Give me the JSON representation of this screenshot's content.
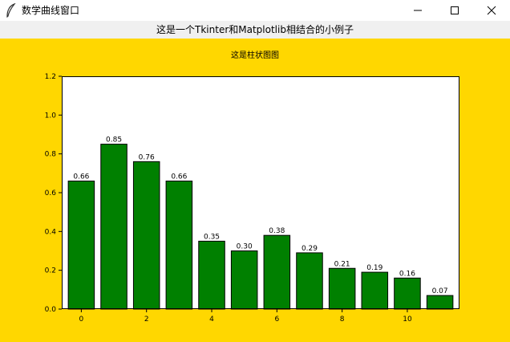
{
  "window": {
    "title": "数学曲线窗口",
    "controls": {
      "minimize": "minimize-icon",
      "maximize": "maximize-icon",
      "close": "close-icon"
    }
  },
  "header_label": "这是一个Tkinter和Matplotlib相结合的小例子",
  "colors": {
    "figure_background": "#ffd700",
    "bar_fill": "#008000",
    "bar_edge": "#000000",
    "plot_background": "#ffffff"
  },
  "chart_data": {
    "type": "bar",
    "title": "这是柱状图图",
    "x": [
      0,
      1,
      2,
      3,
      4,
      5,
      6,
      7,
      8,
      9,
      10,
      11
    ],
    "values": [
      0.66,
      0.85,
      0.76,
      0.66,
      0.35,
      0.3,
      0.38,
      0.29,
      0.21,
      0.19,
      0.16,
      0.07
    ],
    "value_labels": [
      "0.66",
      "0.85",
      "0.76",
      "0.66",
      "0.35",
      "0.30",
      "0.38",
      "0.29",
      "0.21",
      "0.19",
      "0.16",
      "0.07"
    ],
    "xticks": [
      0,
      2,
      4,
      6,
      8,
      10
    ],
    "yticks": [
      "0.0",
      "0.2",
      "0.4",
      "0.6",
      "0.8",
      "1.0",
      "1.2"
    ],
    "xlim": [
      -0.6,
      11.6
    ],
    "ylim": [
      0,
      1.2
    ],
    "grid": false,
    "xlabel": "",
    "ylabel": ""
  }
}
